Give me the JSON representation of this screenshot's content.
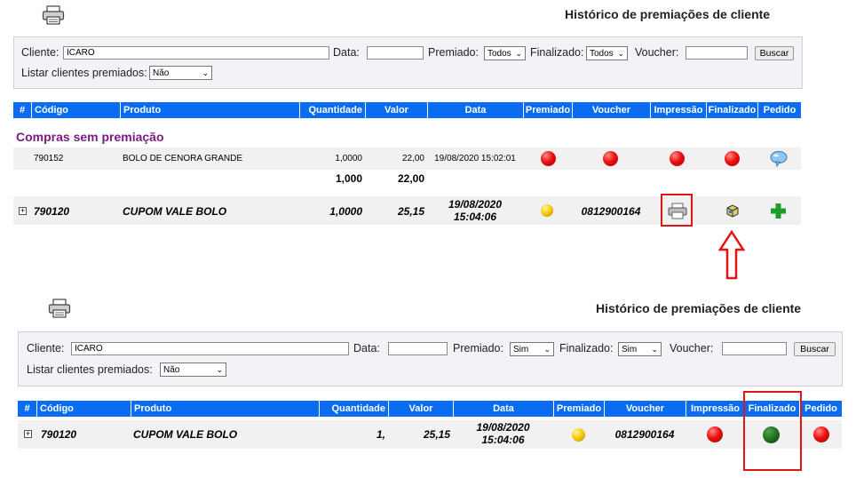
{
  "panel1": {
    "title": "Histórico de premiações de cliente",
    "filters": {
      "cliente_label": "Cliente:",
      "cliente_value": "ICARO",
      "data_label": "Data:",
      "data_value": "",
      "premiado_label": "Premiado:",
      "premiado_value": "Todos",
      "finalizado_label": "Finalizado:",
      "finalizado_value": "Todos",
      "voucher_label": "Voucher:",
      "voucher_value": "",
      "buscar_label": "Buscar",
      "listar_label": "Listar clientes premiados:",
      "listar_value": "Não"
    },
    "table": {
      "headers": [
        "#",
        "Código",
        "Produto",
        "Quantidade",
        "Valor",
        "Data",
        "Premiado",
        "Voucher",
        "Impressão",
        "Finalizado",
        "Pedido"
      ],
      "section_title": "Compras sem premiação",
      "row1": {
        "codigo": "790152",
        "produto": "BOLO DE CENORA GRANDE",
        "quantidade": "1,0000",
        "valor": "22,00",
        "data": "19/08/2020 15:02:01"
      },
      "totals": {
        "quantidade": "1,000",
        "valor": "22,00"
      },
      "row2": {
        "expand": "+",
        "codigo": "790120",
        "produto": "CUPOM VALE BOLO",
        "quantidade": "1,0000",
        "valor": "25,15",
        "data_line1": "19/08/2020",
        "data_line2": "15:04:06",
        "voucher": "0812900164"
      }
    },
    "colors": {
      "premiado_row1": "red",
      "voucher_row1": "red",
      "impressao_row1": "red",
      "finalizado_row1": "red",
      "premiado_row2": "yellow"
    },
    "icons": {
      "pedido_row1": "speech-bubble-icon",
      "impressao_row2": "printer-icon",
      "finalizado_row2": "package-icon",
      "pedido_row2": "green-plus-icon"
    }
  },
  "panel2": {
    "title": "Histórico de premiações de cliente",
    "filters": {
      "cliente_label": "Cliente:",
      "cliente_value": "ICARO",
      "data_label": "Data:",
      "data_value": "",
      "premiado_label": "Premiado:",
      "premiado_value": "Sim",
      "finalizado_label": "Finalizado:",
      "finalizado_value": "Sim",
      "voucher_label": "Voucher:",
      "voucher_value": "",
      "buscar_label": "Buscar",
      "listar_label": "Listar clientes premiados:",
      "listar_value": "Não"
    },
    "table": {
      "headers": [
        "#",
        "Código",
        "Produto",
        "Quantidade",
        "Valor",
        "Data",
        "Premiado",
        "Voucher",
        "Impressão",
        "Finalizado",
        "Pedido"
      ],
      "row": {
        "expand": "+",
        "codigo": "790120",
        "produto": "CUPOM VALE BOLO",
        "quantidade": "1,",
        "valor": "25,15",
        "data_line1": "19/08/2020",
        "data_line2": "15:04:06",
        "voucher": "0812900164"
      }
    },
    "colors": {
      "premiado": "yellow",
      "impressao": "red",
      "finalizado": "green",
      "pedido": "red"
    }
  },
  "annotation": {
    "arrow_color": "#e01515"
  }
}
